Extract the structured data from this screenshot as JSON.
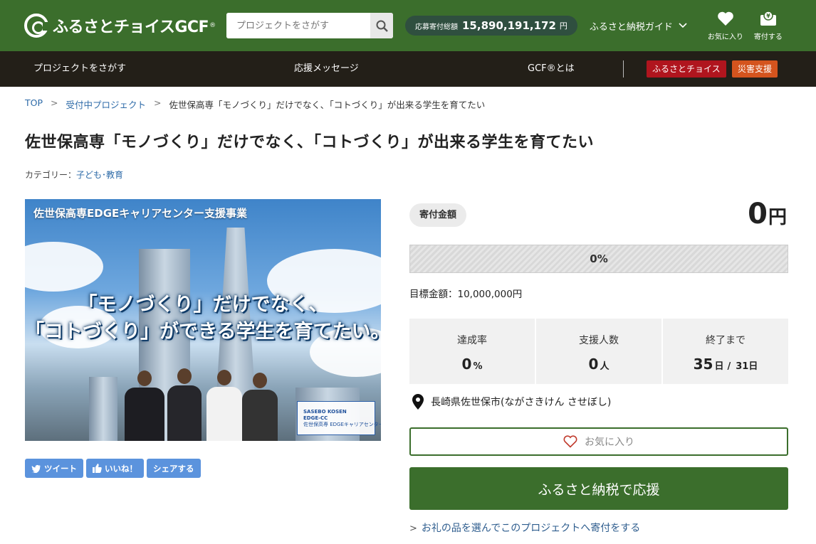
{
  "header": {
    "logo_text": "ふるさとチョイスGCF",
    "logo_reg": "®",
    "search_placeholder": "プロジェクトをさがす",
    "total_label": "応募寄付総額",
    "total_value": "15,890,191,172",
    "total_unit": "円",
    "guide_label": "ふるさと納税ガイド",
    "favorites_label": "お気に入り",
    "donate_label": "寄付する"
  },
  "nav": {
    "items": [
      "プロジェクトをさがす",
      "応援メッセージ",
      "GCF®とは"
    ],
    "badge_choice": "ふるさとチョイス",
    "badge_disaster": "災害支援",
    "badge_choice_color": "#b0151e",
    "badge_disaster_color": "#d4541e"
  },
  "breadcrumb": {
    "top": "TOP",
    "sep": ">",
    "projects": "受付中プロジェクト",
    "current": "佐世保高専「モノづくり」だけでなく､「コトづくり」が出来る学生を育てたい"
  },
  "project": {
    "title": "佐世保高専「モノづくり」だけでなく､「コトづくり」が出来る学生を育てたい",
    "category_label": "カテゴリー：",
    "category_value": "子ども･教育",
    "image": {
      "banner": "佐世保高専EDGEキャリアセンター支援事業",
      "slogan_line1": "「モノづくり」だけでなく、",
      "slogan_line2": "「コトづくり」ができる学生を育てたい。",
      "logo_line1": "SASEBO KOSEN",
      "logo_line2": "EDGE-CC",
      "logo_line3": "佐世保高専 EDGEキャリアセンター"
    }
  },
  "share": {
    "tweet": "ツイート",
    "like": "いいね！",
    "share": "シェアする"
  },
  "funding": {
    "amount_label": "寄付金額",
    "amount_value": "0",
    "amount_unit": "円",
    "progress_percent": 0,
    "progress_text": "0%",
    "target_label": "目標金額：",
    "target_value": "10,000,000円",
    "stats": {
      "rate_label": "達成率",
      "rate_value": "0",
      "rate_unit": "%",
      "supporters_label": "支援人数",
      "supporters_value": "0",
      "supporters_unit": "人",
      "remaining_label": "終了まで",
      "remaining_value": "35",
      "remaining_unit": "日",
      "remaining_sep": "/",
      "remaining_end": "31日"
    },
    "location": "長崎県佐世保市(ながさきけん させぼし)",
    "fav_button": "お気に入り",
    "donate_button": "ふるさと納税で応援",
    "gift_link": "お礼の品を選んでこのプロジェクトへ寄付をする"
  },
  "colors": {
    "brand_green": "#3b6e2c",
    "nav_dark": "#231f18",
    "link_blue": "#2e6ba8",
    "share_blue": "#5b93dd"
  }
}
